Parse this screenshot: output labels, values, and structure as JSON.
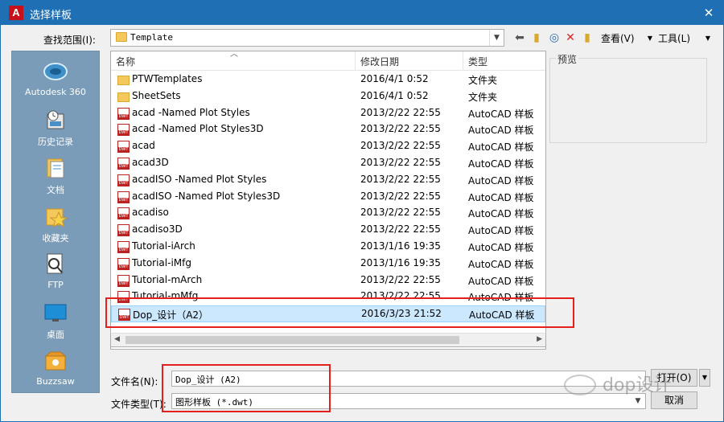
{
  "window": {
    "title": "选择样板",
    "close_glyph": "✕",
    "app_icon_letter": "A"
  },
  "toolbar": {
    "lookin_label": "查找范围(I):",
    "lookin_value": "Template",
    "view_label": "查看(V)",
    "tools_label": "工具(L)",
    "icons": [
      "back-icon",
      "up-folder-icon",
      "search-web-icon",
      "delete-icon",
      "new-folder-icon"
    ]
  },
  "sidebar": {
    "items": [
      {
        "label": "Autodesk 360",
        "icon": "cloud-icon"
      },
      {
        "label": "历史记录",
        "icon": "history-icon"
      },
      {
        "label": "文档",
        "icon": "documents-icon"
      },
      {
        "label": "收藏夹",
        "icon": "favorites-icon"
      },
      {
        "label": "FTP",
        "icon": "ftp-icon"
      },
      {
        "label": "桌面",
        "icon": "desktop-icon"
      },
      {
        "label": "Buzzsaw",
        "icon": "buzzsaw-icon"
      }
    ]
  },
  "filelist": {
    "columns": {
      "name": "名称",
      "date": "修改日期",
      "type": "类型"
    },
    "rows": [
      {
        "name": "PTWTemplates",
        "date": "2016/4/1 0:52",
        "type": "文件夹",
        "kind": "folder"
      },
      {
        "name": "SheetSets",
        "date": "2016/4/1 0:52",
        "type": "文件夹",
        "kind": "folder"
      },
      {
        "name": "acad -Named Plot Styles",
        "date": "2013/2/22 22:55",
        "type": "AutoCAD 样板",
        "kind": "dwt"
      },
      {
        "name": "acad -Named Plot Styles3D",
        "date": "2013/2/22 22:55",
        "type": "AutoCAD 样板",
        "kind": "dwt"
      },
      {
        "name": "acad",
        "date": "2013/2/22 22:55",
        "type": "AutoCAD 样板",
        "kind": "dwt"
      },
      {
        "name": "acad3D",
        "date": "2013/2/22 22:55",
        "type": "AutoCAD 样板",
        "kind": "dwt"
      },
      {
        "name": "acadISO -Named Plot Styles",
        "date": "2013/2/22 22:55",
        "type": "AutoCAD 样板",
        "kind": "dwt"
      },
      {
        "name": "acadISO -Named Plot Styles3D",
        "date": "2013/2/22 22:55",
        "type": "AutoCAD 样板",
        "kind": "dwt"
      },
      {
        "name": "acadiso",
        "date": "2013/2/22 22:55",
        "type": "AutoCAD 样板",
        "kind": "dwt"
      },
      {
        "name": "acadiso3D",
        "date": "2013/2/22 22:55",
        "type": "AutoCAD 样板",
        "kind": "dwt"
      },
      {
        "name": "Tutorial-iArch",
        "date": "2013/1/16 19:35",
        "type": "AutoCAD 样板",
        "kind": "dwt"
      },
      {
        "name": "Tutorial-iMfg",
        "date": "2013/1/16 19:35",
        "type": "AutoCAD 样板",
        "kind": "dwt"
      },
      {
        "name": "Tutorial-mArch",
        "date": "2013/2/22 22:55",
        "type": "AutoCAD 样板",
        "kind": "dwt"
      },
      {
        "name": "Tutorial-mMfg",
        "date": "2013/2/22 22:55",
        "type": "AutoCAD 样板",
        "kind": "dwt"
      },
      {
        "name": "Dop_设计（A2）",
        "date": "2016/3/23 21:52",
        "type": "AutoCAD 样板",
        "kind": "dwt",
        "selected": true
      }
    ]
  },
  "preview": {
    "label": "预览"
  },
  "bottom": {
    "filename_label": "文件名(N):",
    "filename_value": "Dop_设计 (A2)",
    "filetype_label": "文件类型(T):",
    "filetype_value": "图形样板 (*.dwt)",
    "open_button": "打开(O)",
    "cancel_button": "取消"
  },
  "watermark": {
    "text": "dop设计"
  },
  "colors": {
    "titlebar": "#1f6fb4",
    "sidebar": "#7a9cb8",
    "selection": "#cce8ff",
    "annotation": "#e4201f"
  }
}
